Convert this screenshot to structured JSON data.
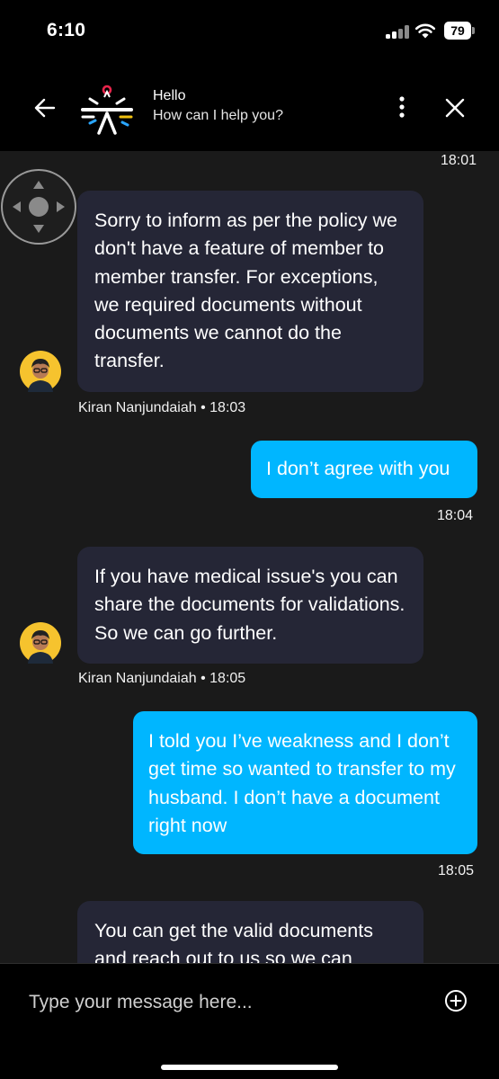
{
  "status_bar": {
    "time": "6:10",
    "battery": "79"
  },
  "header": {
    "title": "Hello",
    "subtitle": "How can I help you?"
  },
  "chat": {
    "top_timestamp": "18:01",
    "messages": [
      {
        "side": "agent",
        "text": "Sorry to inform as per the policy we don't have a feature of member to member transfer. For exceptions, we required documents without documents we cannot do the transfer.",
        "meta": "Kiran Nanjundaiah • 18:03"
      },
      {
        "side": "user",
        "text": "I don’t agree with you",
        "time": "18:04"
      },
      {
        "side": "agent",
        "text": "If you have medical issue's you can share the documents for validations. So we can go further.",
        "meta": "Kiran Nanjundaiah • 18:05"
      },
      {
        "side": "user",
        "text": "I told you I’ve weakness and I don’t get time so wanted to transfer to my husband. I don’t have a document right now",
        "time": "18:05"
      },
      {
        "side": "agent",
        "text": "You can get the valid documents and reach out to us so we can"
      }
    ]
  },
  "input": {
    "placeholder": "Type your message here..."
  },
  "colors": {
    "user_bubble": "#00b6ff",
    "agent_bubble": "#252636",
    "background": "#1a1a1a"
  }
}
